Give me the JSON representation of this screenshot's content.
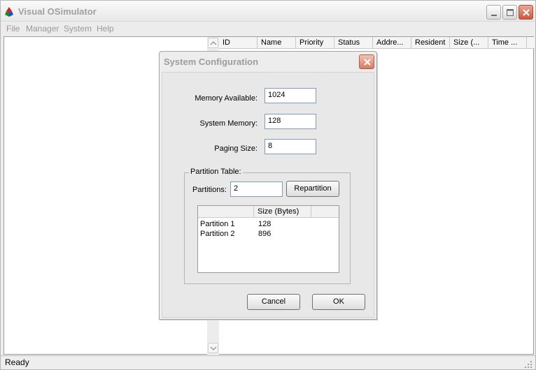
{
  "window": {
    "title": "Visual OSimulator",
    "accent_close": "#c9593e"
  },
  "menu": {
    "items": [
      "File",
      "Manager",
      "System",
      "Help"
    ]
  },
  "process_list": {
    "columns": [
      "ID",
      "Name",
      "Priority",
      "Status",
      "Addre...",
      "Resident",
      "Size (...",
      "Time ..."
    ]
  },
  "status_bar": {
    "text": "Ready"
  },
  "dialog": {
    "title": "System Configuration",
    "fields": {
      "memory_available": {
        "label": "Memory Available:",
        "value": "1024"
      },
      "system_memory": {
        "label": "System Memory:",
        "value": "128"
      },
      "paging_size": {
        "label": "Paging Size:",
        "value": "8"
      }
    },
    "partition_table": {
      "caption": "Partition Table:",
      "partitions_label": "Partitions:",
      "partitions_value": "2",
      "repartition_label": "Repartition",
      "columns": [
        "",
        "Size (Bytes)",
        ""
      ],
      "rows": [
        {
          "name": "Partition 1",
          "size": "128"
        },
        {
          "name": "Partition 2",
          "size": "896"
        }
      ]
    },
    "cancel_label": "Cancel",
    "ok_label": "OK"
  }
}
